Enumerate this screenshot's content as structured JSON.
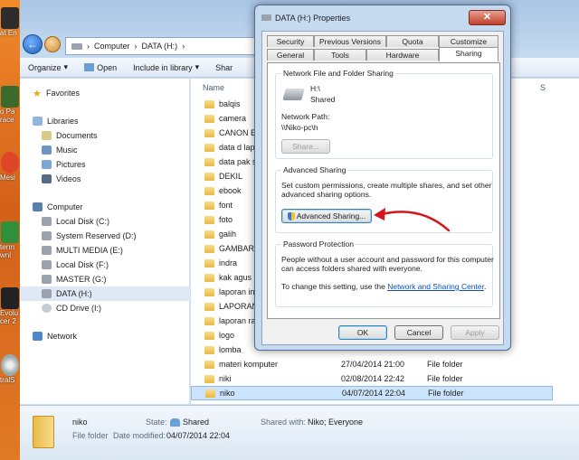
{
  "desktop": {
    "icons": [
      {
        "label": "at En"
      },
      {
        "label": "o Pa"
      },
      {
        "label": "race"
      },
      {
        "label": "Mesi"
      },
      {
        "label": "term"
      },
      {
        "label": "wnl"
      },
      {
        "label": "Evolu"
      },
      {
        "label": "cer 2"
      },
      {
        "label": "tralS"
      }
    ]
  },
  "explorer": {
    "address": [
      "Computer",
      "DATA (H:)"
    ],
    "toolbar": {
      "organize": "Organize",
      "open": "Open",
      "include": "Include in library",
      "share": "Shar"
    },
    "nav": {
      "favorites": "Favorites",
      "libraries": "Libraries",
      "documents": "Documents",
      "music": "Music",
      "pictures": "Pictures",
      "videos": "Videos",
      "computer": "Computer",
      "drives": [
        "Local Disk (C:)",
        "System Reserved (D:)",
        "MULTI MEDIA (E:)",
        "Local Disk (F:)",
        "MASTER (G:)",
        "DATA (H:)",
        "CD Drive (I:)"
      ],
      "network": "Network"
    },
    "list": {
      "col_name": "Name",
      "col_s": "S",
      "files": [
        {
          "name": "balqis",
          "date": "",
          "type": ""
        },
        {
          "name": "camera",
          "date": "",
          "type": ""
        },
        {
          "name": "CANON E",
          "date": "",
          "type": ""
        },
        {
          "name": "data d lapt",
          "date": "",
          "type": ""
        },
        {
          "name": "data pak s",
          "date": "",
          "type": ""
        },
        {
          "name": "DEKIL",
          "date": "",
          "type": ""
        },
        {
          "name": "ebook",
          "date": "",
          "type": ""
        },
        {
          "name": "font",
          "date": "",
          "type": ""
        },
        {
          "name": "foto",
          "date": "",
          "type": ""
        },
        {
          "name": "galih",
          "date": "",
          "type": ""
        },
        {
          "name": "GAMBAR_",
          "date": "",
          "type": ""
        },
        {
          "name": "indra",
          "date": "",
          "type": ""
        },
        {
          "name": "kak agus",
          "date": "",
          "type": ""
        },
        {
          "name": "laporan in",
          "date": "",
          "type": ""
        },
        {
          "name": "LAPORAN",
          "date": "",
          "type": ""
        },
        {
          "name": "laporan ra",
          "date": "",
          "type": ""
        },
        {
          "name": "logo",
          "date": "",
          "type": ""
        },
        {
          "name": "lomba",
          "date": "",
          "type": ""
        },
        {
          "name": "materi komputer",
          "date": "27/04/2014 21:00",
          "type": "File folder"
        },
        {
          "name": "niki",
          "date": "02/08/2014 22:42",
          "type": "File folder"
        },
        {
          "name": "niko",
          "date": "04/07/2014 22:04",
          "type": "File folder"
        }
      ]
    },
    "details": {
      "name": "niko",
      "kind": "File folder",
      "state_label": "State:",
      "state_value": "Shared",
      "shared_label": "Shared with:",
      "shared_value": "Niko; Everyone",
      "modified_label": "Date modified:",
      "modified_value": "04/07/2014 22:04"
    }
  },
  "dialog": {
    "title": "DATA (H:) Properties",
    "close": "✕",
    "tabs_row1": [
      "Security",
      "Previous Versions",
      "Quota",
      "Customize"
    ],
    "tabs_row2": [
      "General",
      "Tools",
      "Hardware",
      "Sharing"
    ],
    "nfs": {
      "title": "Network File and Folder Sharing",
      "drive": "H:\\",
      "status": "Shared",
      "path_label": "Network Path:",
      "path_value": "\\\\Niko-pc\\h",
      "share_btn": "Share..."
    },
    "adv": {
      "title": "Advanced Sharing",
      "desc1": "Set custom permissions, create multiple shares, and set other",
      "desc2": "advanced sharing options.",
      "btn": "Advanced Sharing..."
    },
    "pwd": {
      "title": "Password Protection",
      "desc1": "People without a user account and password for this computer",
      "desc2": "can access folders shared with everyone.",
      "change_prefix": "To change this setting, use the",
      "link": "Network and Sharing Center",
      "change_suffix": "."
    },
    "buttons": {
      "ok": "OK",
      "cancel": "Cancel",
      "apply": "Apply"
    }
  }
}
